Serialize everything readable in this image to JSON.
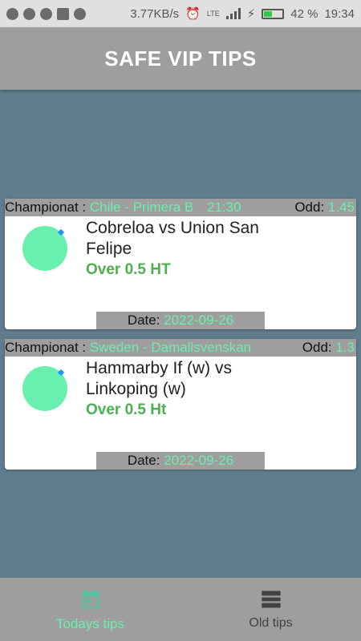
{
  "status_bar": {
    "speed": "3.77KB/s",
    "battery_percent": "42 %",
    "time": "19:34",
    "network": "LTE"
  },
  "app_bar": {
    "title": "SAFE VIP TIPS"
  },
  "tips": [
    {
      "championat_label": "Championat :",
      "championat": "Chile - Primera B",
      "time": "21:30",
      "odd_label": "Odd:",
      "odd": "1.45",
      "teams": "Cobreloa vs Union San Felipe",
      "tip": "Over 0.5 HT",
      "date_label": "Date:",
      "date": "2022-09-26"
    },
    {
      "championat_label": "Championat :",
      "championat": "Sweden - Damallsvenskan",
      "time": "",
      "odd_label": "Odd:",
      "odd": "1.3",
      "teams": "Hammarby If (w) vs Linkoping (w)",
      "tip": "Over 0.5 Ht",
      "date_label": "Date:",
      "date": "2022-09-26"
    }
  ],
  "bottom_nav": {
    "items": [
      {
        "label": "Todays tips",
        "icon": "calendar-icon",
        "active": true
      },
      {
        "label": "Old tips",
        "icon": "list-icon",
        "active": false
      }
    ]
  },
  "colors": {
    "accent": "#69f0ae",
    "tip_green": "#4caf50",
    "background": "#607d8b",
    "header_grey": "#9e9e9e"
  }
}
